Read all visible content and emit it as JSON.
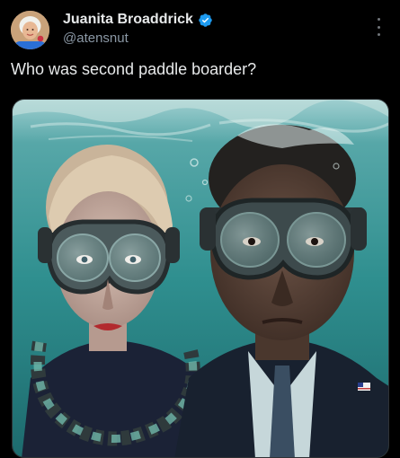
{
  "post": {
    "author": {
      "display_name": "Juanita Broaddrick",
      "handle": "@atensnut",
      "verified": true,
      "avatar_icon": "avatar-icon",
      "verified_icon": "verified-badge-icon"
    },
    "text": "Who was second paddle boarder?",
    "menu_icon": "more-vertical-icon",
    "media": {
      "kind": "image",
      "subject": "two figures wearing diving masks underwater"
    }
  },
  "colors": {
    "background": "#000000",
    "text_primary": "#e7e9ea",
    "text_secondary": "#8b98a5",
    "verified_blue": "#1d9bf0",
    "water": "#2f8f8f"
  }
}
